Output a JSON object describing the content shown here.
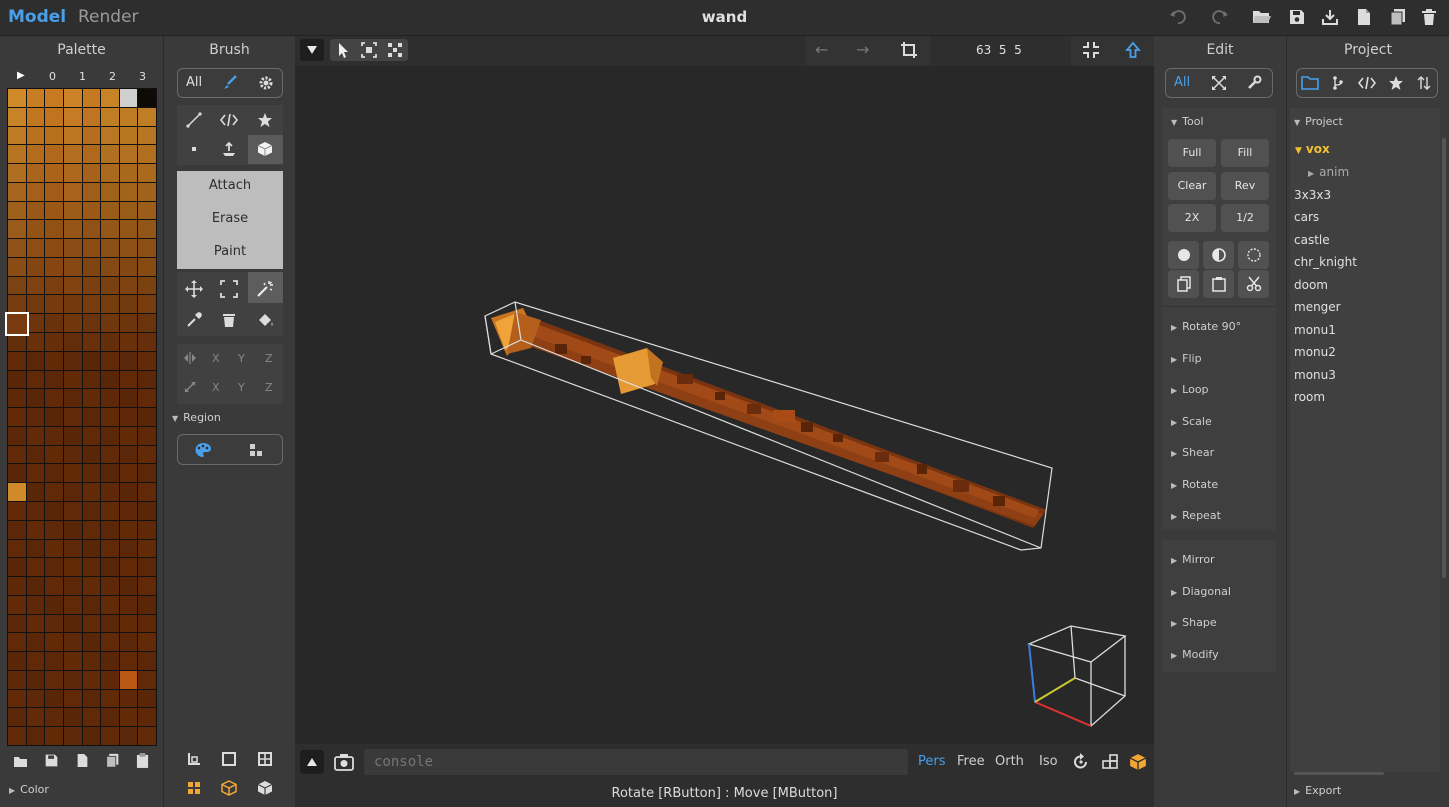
{
  "header": {
    "tabs": [
      "Model",
      "Render"
    ],
    "title": "wand"
  },
  "palette": {
    "title": "Palette",
    "columns": [
      "▶",
      "0",
      "1",
      "2",
      "3"
    ],
    "footer_label": "Color",
    "colors": [
      "#d08a2a",
      "#c97d22",
      "#c77a20",
      "#cc8226",
      "#c57a22",
      "#c68426",
      "#cfcfcf",
      "#0e0a06"
    ]
  },
  "brush": {
    "title": "Brush",
    "filter_all": "All",
    "modes": [
      "Attach",
      "Erase",
      "Paint"
    ],
    "axis_labels": [
      "X",
      "Y",
      "Z"
    ],
    "region_label": "Region"
  },
  "viewport": {
    "coords": "63  5  5",
    "console_placeholder": "console",
    "view_modes": [
      "Pers",
      "Free",
      "Orth",
      "Iso"
    ],
    "active_view": "Pers",
    "status": "Rotate [RButton] : Move [MButton]"
  },
  "edit": {
    "title": "Edit",
    "filter_all": "All",
    "tool_label": "Tool",
    "tool_buttons": [
      "Full",
      "Fill",
      "Clear",
      "Rev",
      "2X",
      "1/2"
    ],
    "sections1": [
      "Rotate 90°",
      "Flip",
      "Loop",
      "Scale",
      "Shear",
      "Rotate",
      "Repeat"
    ],
    "sections2": [
      "Mirror",
      "Diagonal",
      "Shape",
      "Modify"
    ]
  },
  "project": {
    "title": "Project",
    "section_label": "Project",
    "folder": "vox",
    "subfolder": "anim",
    "items": [
      "3x3x3",
      "cars",
      "castle",
      "chr_knight",
      "doom",
      "menger",
      "monu1",
      "monu2",
      "monu3",
      "room"
    ],
    "footer_label": "Export"
  }
}
